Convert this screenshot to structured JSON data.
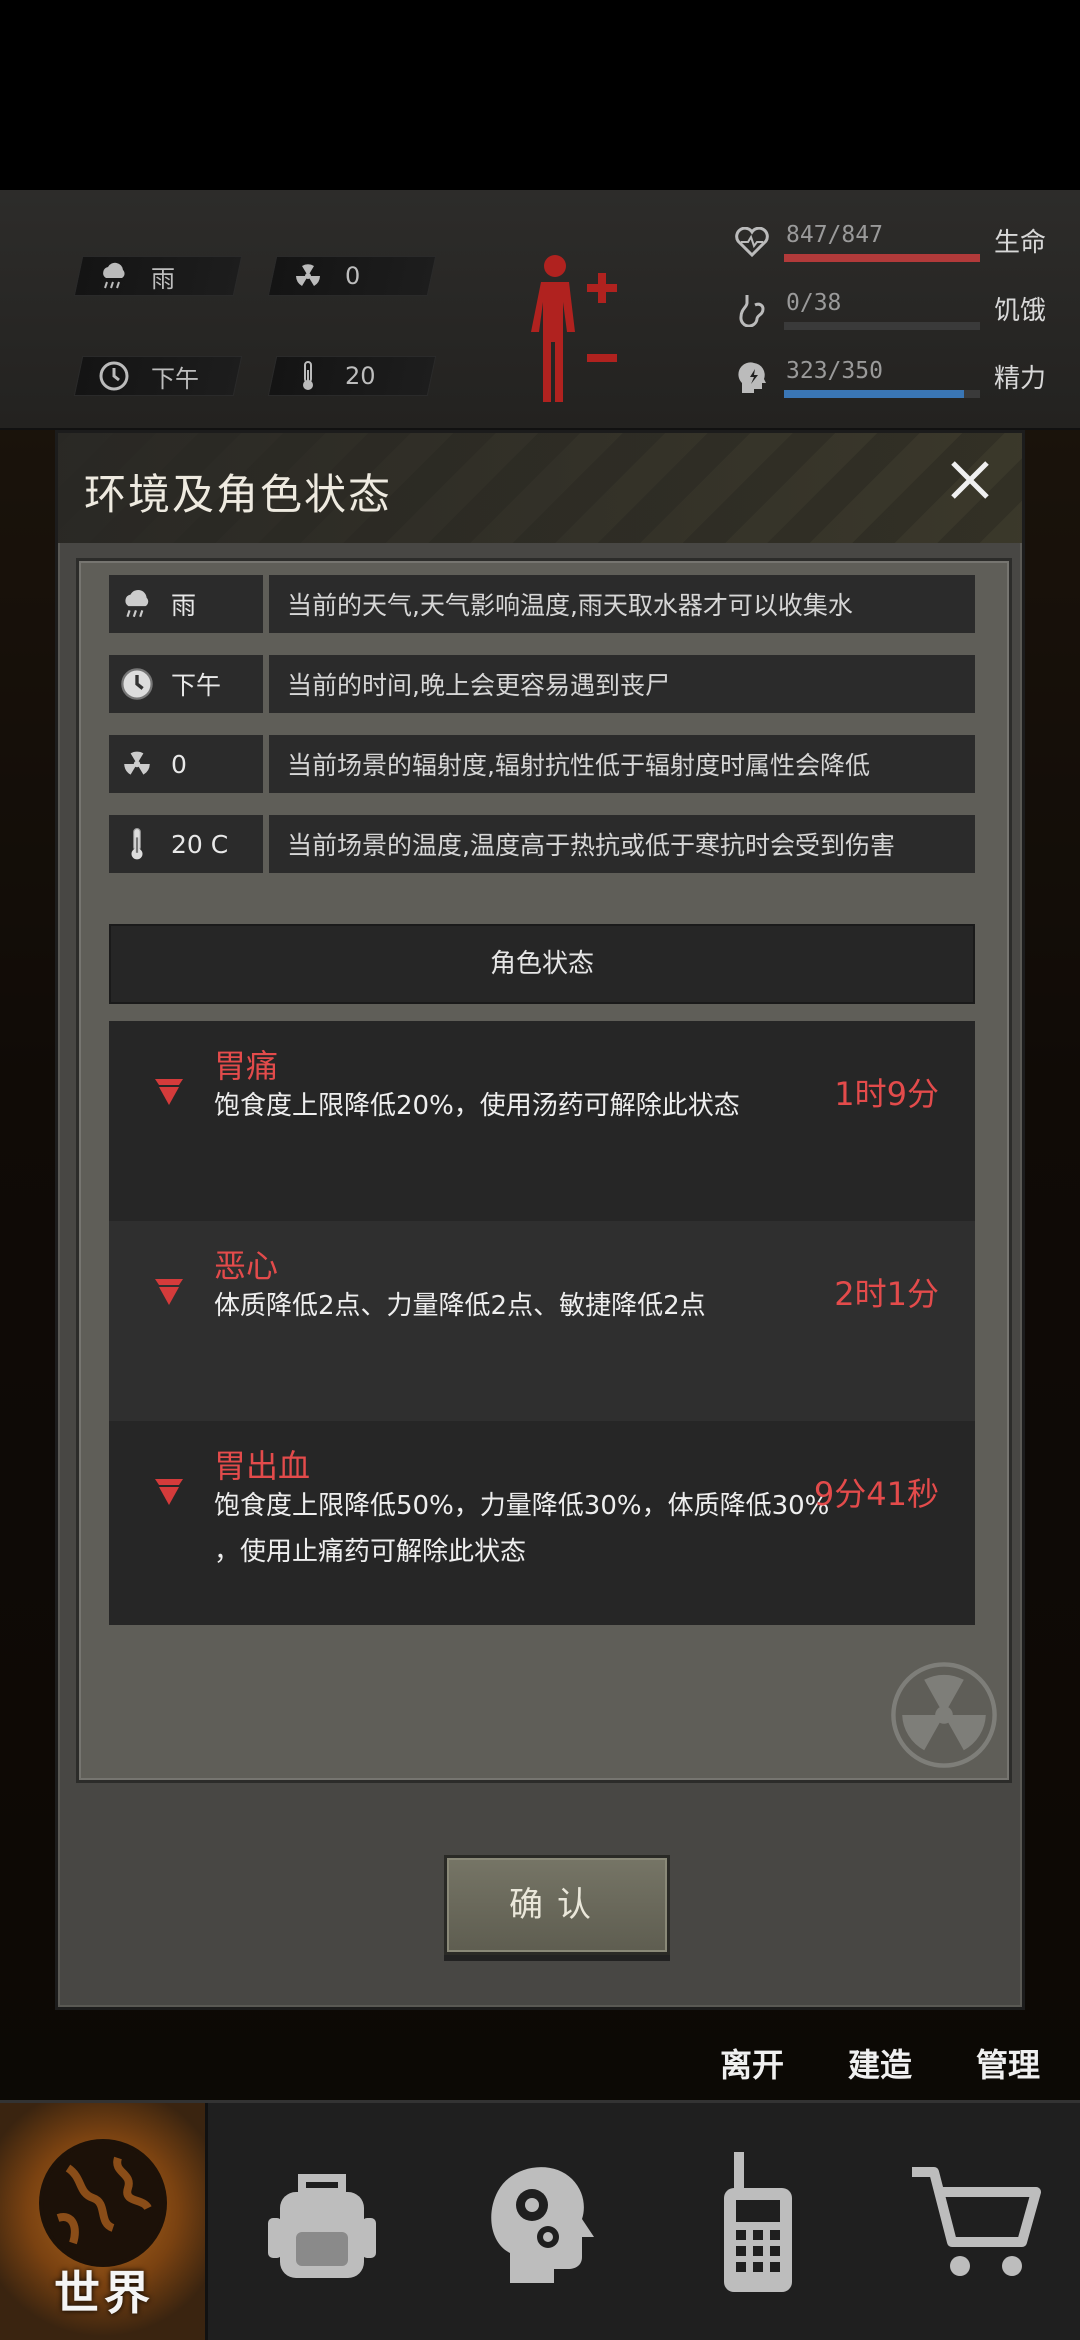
{
  "top_status": {
    "weather": {
      "icon": "rain-cloud-icon",
      "value": "雨"
    },
    "radiation": {
      "icon": "radiation-icon",
      "value": "0"
    },
    "time": {
      "icon": "clock-icon",
      "value": "下午"
    },
    "temperature": {
      "icon": "thermometer-icon",
      "value": "20"
    },
    "stats": [
      {
        "icon": "heart-icon",
        "value": "847/847",
        "label": "生命",
        "fill": 1.0,
        "color": "#b23a3a"
      },
      {
        "icon": "stomach-icon",
        "value": "0/38",
        "label": "饥饿",
        "fill": 0.0,
        "color": "#b0a24a"
      },
      {
        "icon": "head-bolt-icon",
        "value": "323/350",
        "label": "精力",
        "fill": 0.92,
        "color": "#3a76b5"
      }
    ]
  },
  "dialog": {
    "title": "环境及角色状态",
    "env_rows": [
      {
        "icon": "rain-cloud-icon",
        "value": "雨",
        "desc": "当前的天气,天气影响温度,雨天取水器才可以收集水"
      },
      {
        "icon": "clock-icon",
        "value": "下午",
        "desc": "当前的时间,晚上会更容易遇到丧尸"
      },
      {
        "icon": "radiation-icon",
        "value": "0",
        "desc": "当前场景的辐射度,辐射抗性低于辐射度时属性会降低"
      },
      {
        "icon": "thermometer-icon",
        "value": "20 C",
        "desc": "当前场景的温度,温度高于热抗或低于寒抗时会受到伤害"
      }
    ],
    "status_header": "角色状态",
    "statuses": [
      {
        "name": "胃痛",
        "desc": [
          "饱食度上限降低20%，使用汤药可解除此状态"
        ],
        "time": "1时9分"
      },
      {
        "name": "恶心",
        "desc": [
          "体质降低2点、力量降低2点、敏捷降低2点"
        ],
        "time": "2时1分"
      },
      {
        "name": "胃出血",
        "desc": [
          "饱食度上限降低50%，力量降低30%，体质降低30%",
          "，使用止痛药可解除此状态"
        ],
        "time": "9分41秒"
      }
    ],
    "confirm_label": "确认"
  },
  "side_menu": [
    "离开",
    "建造",
    "管理"
  ],
  "bottom_nav": [
    {
      "icon": "globe-icon",
      "label": "世界",
      "active": true
    },
    {
      "icon": "backpack-icon",
      "label": "",
      "active": false
    },
    {
      "icon": "brain-gear-icon",
      "label": "",
      "active": false
    },
    {
      "icon": "walkie-talkie-icon",
      "label": "",
      "active": false
    },
    {
      "icon": "shopping-cart-icon",
      "label": "",
      "active": false
    }
  ]
}
